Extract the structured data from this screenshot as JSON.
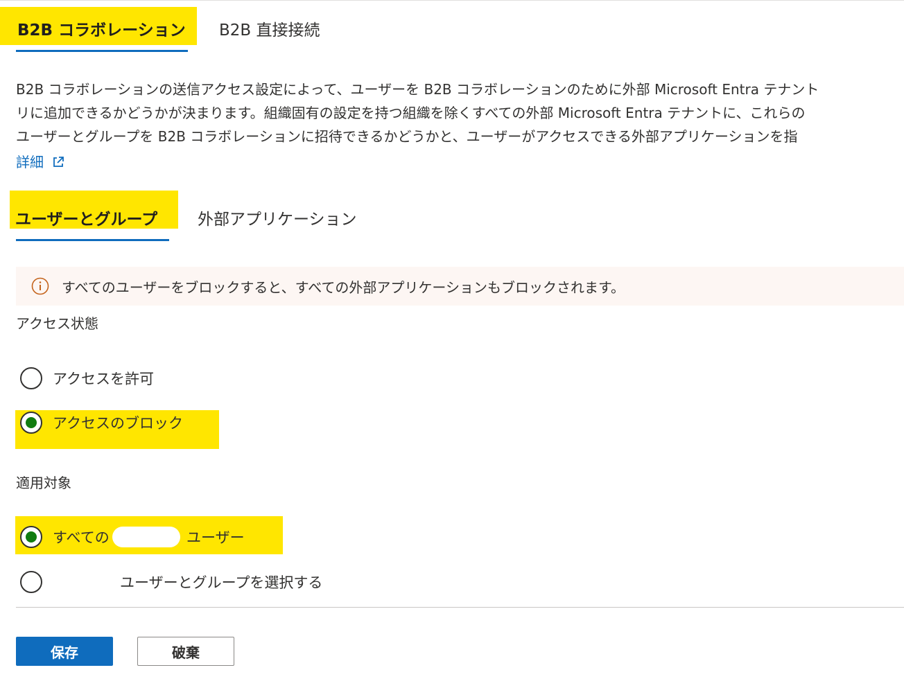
{
  "top_tabs": [
    {
      "label": "B2B コラボレーション",
      "active": true
    },
    {
      "label": "B2B 直接接続",
      "active": false
    }
  ],
  "description": {
    "lines": [
      "B2B コラボレーションの送信アクセス設定によって、ユーザーを B2B コラボレーションのために外部 Microsoft Entra テナント",
      "リに追加できるかどうかが決まります。組織固有の設定を持つ組織を除くすべての外部 Microsoft Entra テナントに、これらの",
      "ユーザーとグループを B2B コラボレーションに招待できるかどうかと、ユーザーがアクセスできる外部アプリケーションを指"
    ],
    "learn_more": "詳細"
  },
  "sub_tabs": [
    {
      "label": "ユーザーとグループ",
      "active": true
    },
    {
      "label": "外部アプリケーション",
      "active": false
    }
  ],
  "info_banner": {
    "text": "すべてのユーザーをブロックすると、すべての外部アプリケーションもブロックされます。"
  },
  "access_status": {
    "label": "アクセス状態",
    "options": [
      {
        "label": "アクセスを許可",
        "checked": false
      },
      {
        "label": "アクセスのブロック",
        "checked": true
      }
    ]
  },
  "applies_to": {
    "label": "適用対象",
    "options": [
      {
        "label_prefix": "すべての",
        "label_suffix": "ユーザー",
        "checked": true
      },
      {
        "label": "ユーザーとグループを選択する",
        "checked": false
      }
    ]
  },
  "actions": {
    "save": "保存",
    "discard": "破棄"
  },
  "colors": {
    "accent": "#0f6cbd",
    "highlight": "#ffe600",
    "radio_checked": "#107c10",
    "banner_bg": "#fdf6f3",
    "warning_icon": "#c4631b"
  }
}
